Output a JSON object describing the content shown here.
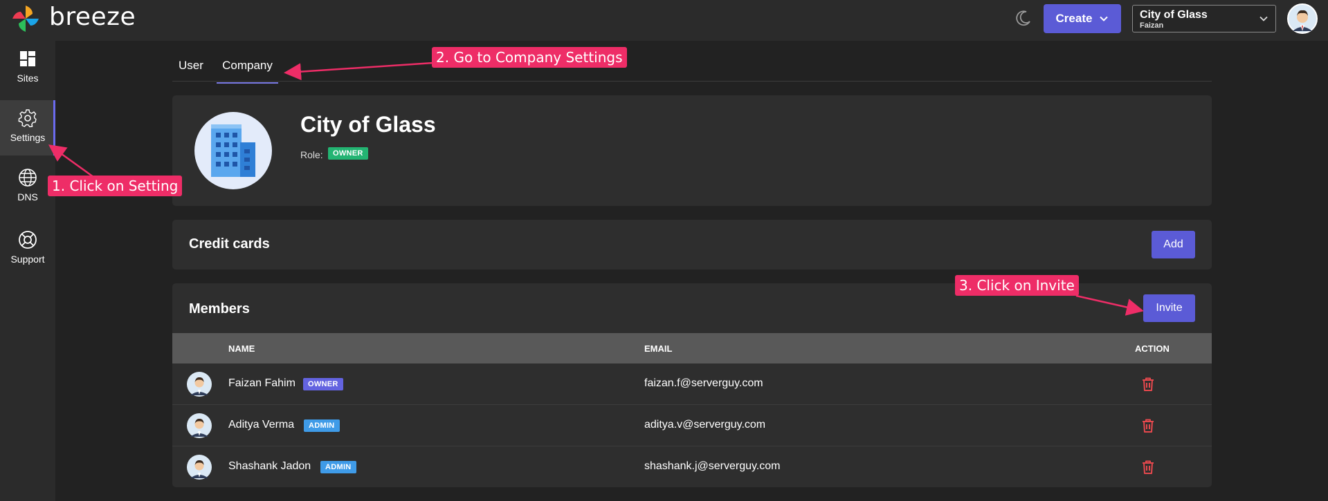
{
  "header": {
    "brand": "breeze",
    "create_label": "Create",
    "company_select": {
      "company": "City of Glass",
      "user": "Faizan"
    }
  },
  "sidebar": {
    "items": [
      {
        "label": "Sites",
        "icon": "dashboard-grid-icon"
      },
      {
        "label": "Settings",
        "icon": "gear-icon",
        "active": true
      },
      {
        "label": "DNS",
        "icon": "globe-icon"
      },
      {
        "label": "Support",
        "icon": "lifebuoy-icon"
      }
    ]
  },
  "tabs": [
    {
      "label": "User"
    },
    {
      "label": "Company",
      "active": true
    }
  ],
  "company": {
    "name": "City of Glass",
    "role_label": "Role:",
    "role_badge": "OWNER",
    "logo_icon": "building-icon"
  },
  "credit_cards": {
    "title": "Credit cards",
    "add_label": "Add"
  },
  "members": {
    "title": "Members",
    "invite_label": "Invite",
    "columns": {
      "name": "NAME",
      "email": "EMAIL",
      "action": "ACTION"
    },
    "rows": [
      {
        "name": "Faizan Fahim",
        "badge": "OWNER",
        "email": "faizan.f@serverguy.com"
      },
      {
        "name": "Aditya Verma",
        "badge": "ADMIN",
        "email": "aditya.v@serverguy.com"
      },
      {
        "name": "Shashank Jadon",
        "badge": "ADMIN",
        "email": "shashank.j@serverguy.com"
      }
    ]
  },
  "annotations": {
    "step1": "1. Click on Setting",
    "step2": "2. Go to Company Settings",
    "step3": "3. Click on Invite"
  },
  "colors": {
    "accent": "#5b5bd6",
    "annotation": "#ee2d67",
    "owner_role_badge": "#23b472",
    "delete": "#e5484d"
  }
}
